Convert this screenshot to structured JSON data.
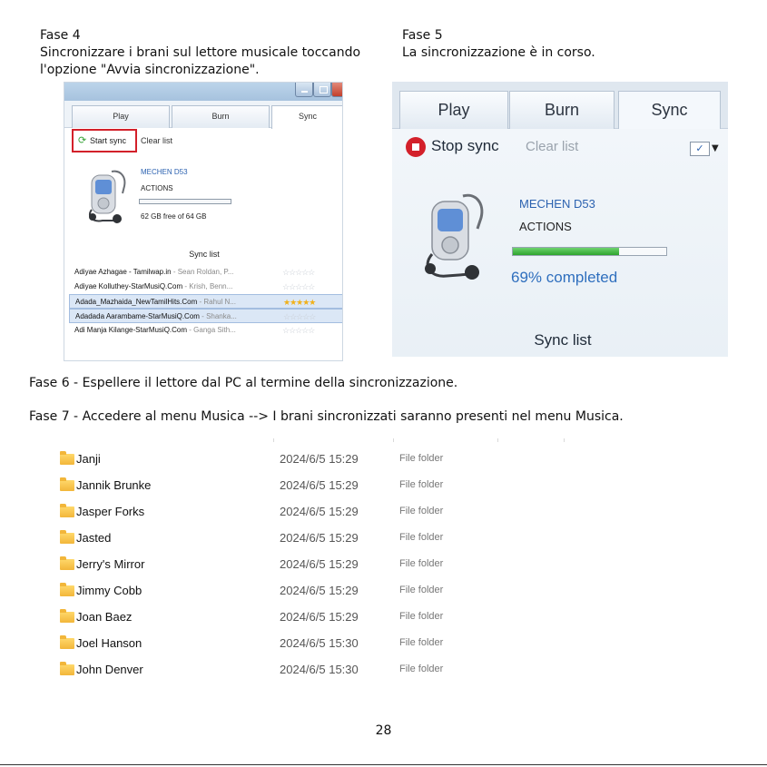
{
  "fase4": {
    "heading": "Fase 4",
    "line1": "Sincronizzare i brani sul lettore musicale toccando",
    "line2": "l'opzione \"Avvia sincronizzazione\"."
  },
  "fase5": {
    "heading": "Fase 5",
    "line1": "La sincronizzazione è in corso."
  },
  "screenshot1": {
    "tabs": [
      "Play",
      "Burn",
      "Sync"
    ],
    "start_sync": "Start sync",
    "clear_list": "Clear list",
    "device_name": "MECHEN D53",
    "device_maker": "ACTIONS",
    "storage": "62 GB free of 64 GB",
    "sync_list_title": "Sync list",
    "sync_rows": [
      {
        "title": "Adiyae Azhagae - Tamilwap.in",
        "artist": " - Sean Roldan, P...",
        "rating": 0,
        "selected": false
      },
      {
        "title": "Adiyae Kolluthey-StarMusiQ.Com",
        "artist": " - Krish, Benn...",
        "rating": 0,
        "selected": false
      },
      {
        "title": "Adada_Mazhaida_NewTamilHits.Com",
        "artist": " - Rahul N...",
        "rating": 5,
        "selected": true
      },
      {
        "title": "Adadada Aarambame-StarMusiQ.Com",
        "artist": " - Shanka...",
        "rating": 0,
        "selected": true
      },
      {
        "title": "Adi Manja Kilange-StarMusiQ.Com",
        "artist": " - Ganga Sith...",
        "rating": 0,
        "selected": false
      }
    ]
  },
  "screenshot2": {
    "tabs": [
      "Play",
      "Burn",
      "Sync"
    ],
    "stop_sync": "Stop sync",
    "clear_list": "Clear list",
    "device_name": "MECHEN D53",
    "device_maker": "ACTIONS",
    "progress_fraction": 0.69,
    "progress_text": "69% completed",
    "sync_list_title": "Sync list"
  },
  "fase6": "Fase 6 - Espellere il lettore dal PC al termine della sincronizzazione.",
  "fase7": "Fase 7 - Accedere al menu Musica --> I brani sincronizzati saranno presenti nel menu Musica.",
  "folders": [
    {
      "name": "Janji",
      "date": "2024/6/5 15:29",
      "type": "File folder"
    },
    {
      "name": "Jannik Brunke",
      "date": "2024/6/5 15:29",
      "type": "File folder"
    },
    {
      "name": "Jasper Forks",
      "date": "2024/6/5 15:29",
      "type": "File folder"
    },
    {
      "name": "Jasted",
      "date": "2024/6/5 15:29",
      "type": "File folder"
    },
    {
      "name": "Jerry's Mirror",
      "date": "2024/6/5 15:29",
      "type": "File folder"
    },
    {
      "name": "Jimmy Cobb",
      "date": "2024/6/5 15:29",
      "type": "File folder"
    },
    {
      "name": "Joan Baez",
      "date": "2024/6/5 15:29",
      "type": "File folder"
    },
    {
      "name": "Joel Hanson",
      "date": "2024/6/5 15:30",
      "type": "File folder"
    },
    {
      "name": "John Denver",
      "date": "2024/6/5 15:30",
      "type": "File folder"
    }
  ],
  "page_number": "28",
  "colors": {
    "highlight_red": "#d3202a",
    "progress_green": "#2ea42e",
    "link_blue": "#2f6fbe",
    "folder_yellow": "#f2b63a"
  },
  "icons": [
    "sync-icon",
    "stop-icon",
    "music-player-icon",
    "folder-icon",
    "star-icon",
    "checkbox-icon",
    "chevron-down-icon"
  ]
}
